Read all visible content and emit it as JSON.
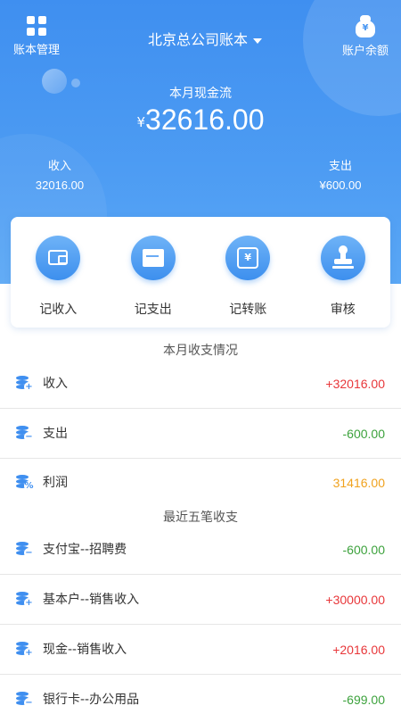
{
  "header": {
    "left_label": "账本管理",
    "book_title": "北京总公司账本",
    "right_label": "账户余额",
    "cash_label": "本月现金流",
    "cash_currency": "¥",
    "cash_amount": "32616.00",
    "income_label": "收入",
    "income_value": "32016.00",
    "expense_label": "支出",
    "expense_value": "¥600.00"
  },
  "actions": [
    {
      "label": "记收入",
      "icon": "wallet-icon"
    },
    {
      "label": "记支出",
      "icon": "envelope-icon"
    },
    {
      "label": "记转账",
      "icon": "transfer-icon"
    },
    {
      "label": "审核",
      "icon": "stamp-icon"
    }
  ],
  "monthly": {
    "title": "本月收支情况",
    "rows": [
      {
        "name": "收入",
        "amount": "+32016.00",
        "icon": "coin-plus-icon"
      },
      {
        "name": "支出",
        "amount": "-600.00",
        "icon": "coin-minus-icon"
      },
      {
        "name": "利润",
        "amount": "31416.00",
        "icon": "coin-percent-icon"
      }
    ]
  },
  "recent": {
    "title": "最近五笔收支",
    "rows": [
      {
        "name": "支付宝--招聘费",
        "amount": "-600.00",
        "icon": "coin-minus-icon"
      },
      {
        "name": "基本户--销售收入",
        "amount": "+30000.00",
        "icon": "coin-plus-icon"
      },
      {
        "name": "现金--销售收入",
        "amount": "+2016.00",
        "icon": "coin-plus-icon"
      },
      {
        "name": "银行卡--办公用品",
        "amount": "-699.00",
        "icon": "coin-minus-icon"
      }
    ]
  },
  "colors": {
    "primary": "#3f8ff0",
    "positive": "#e8373a",
    "negative": "#3da23d",
    "profit": "#f0a21e"
  }
}
